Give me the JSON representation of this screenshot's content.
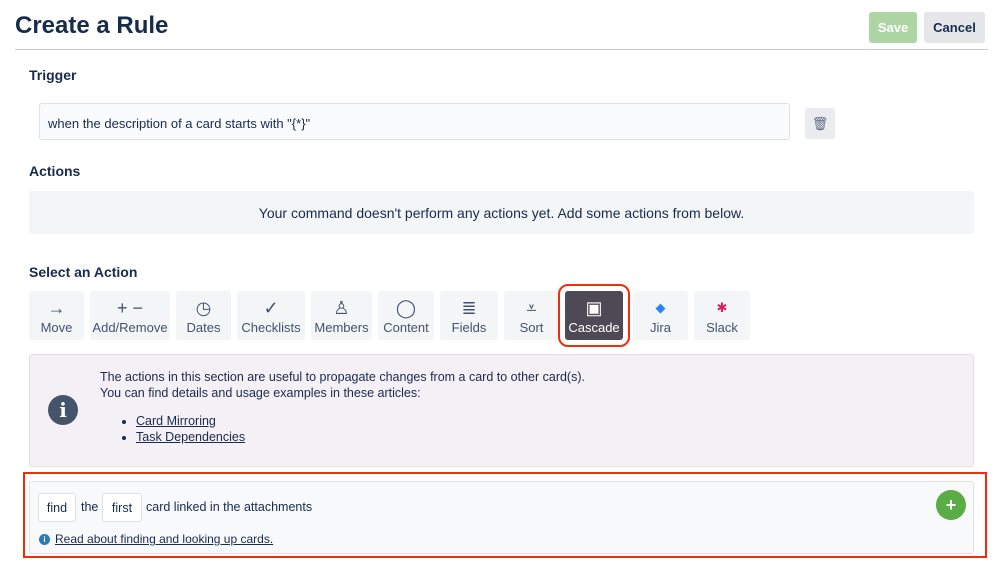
{
  "header": {
    "title": "Create a Rule",
    "save": "Save",
    "cancel": "Cancel"
  },
  "trigger": {
    "label": "Trigger",
    "text": "when the description of a card starts with \"{*}\""
  },
  "actions": {
    "label": "Actions",
    "empty": "Your command doesn't perform any actions yet. Add some actions from below."
  },
  "select": {
    "label": "Select an Action",
    "tabs": [
      {
        "label": "Move",
        "icon": "→"
      },
      {
        "label": "Add/Remove",
        "icon": "+ −"
      },
      {
        "label": "Dates",
        "icon": "◷"
      },
      {
        "label": "Checklists",
        "icon": "✓"
      },
      {
        "label": "Members",
        "icon": "♙"
      },
      {
        "label": "Content",
        "icon": "◯"
      },
      {
        "label": "Fields",
        "icon": "≣"
      },
      {
        "label": "Sort",
        "icon": "⩡"
      },
      {
        "label": "Cascade",
        "icon": "▣"
      },
      {
        "label": "Jira",
        "icon": "◆"
      },
      {
        "label": "Slack",
        "icon": "✱"
      }
    ]
  },
  "info": {
    "line1": "The actions in this section are useful to propagate changes from a card to other card(s).",
    "line2": "You can find details and usage examples in these articles:",
    "links": [
      "Card Mirroring",
      "Task Dependencies"
    ]
  },
  "action_card": {
    "verb": "find",
    "the": "the",
    "which": "first",
    "rest": "card linked in the attachments",
    "help": "Read about finding and looking up cards."
  },
  "colors": {
    "accent": "#5aac44",
    "highlight": "#f12b0c"
  }
}
